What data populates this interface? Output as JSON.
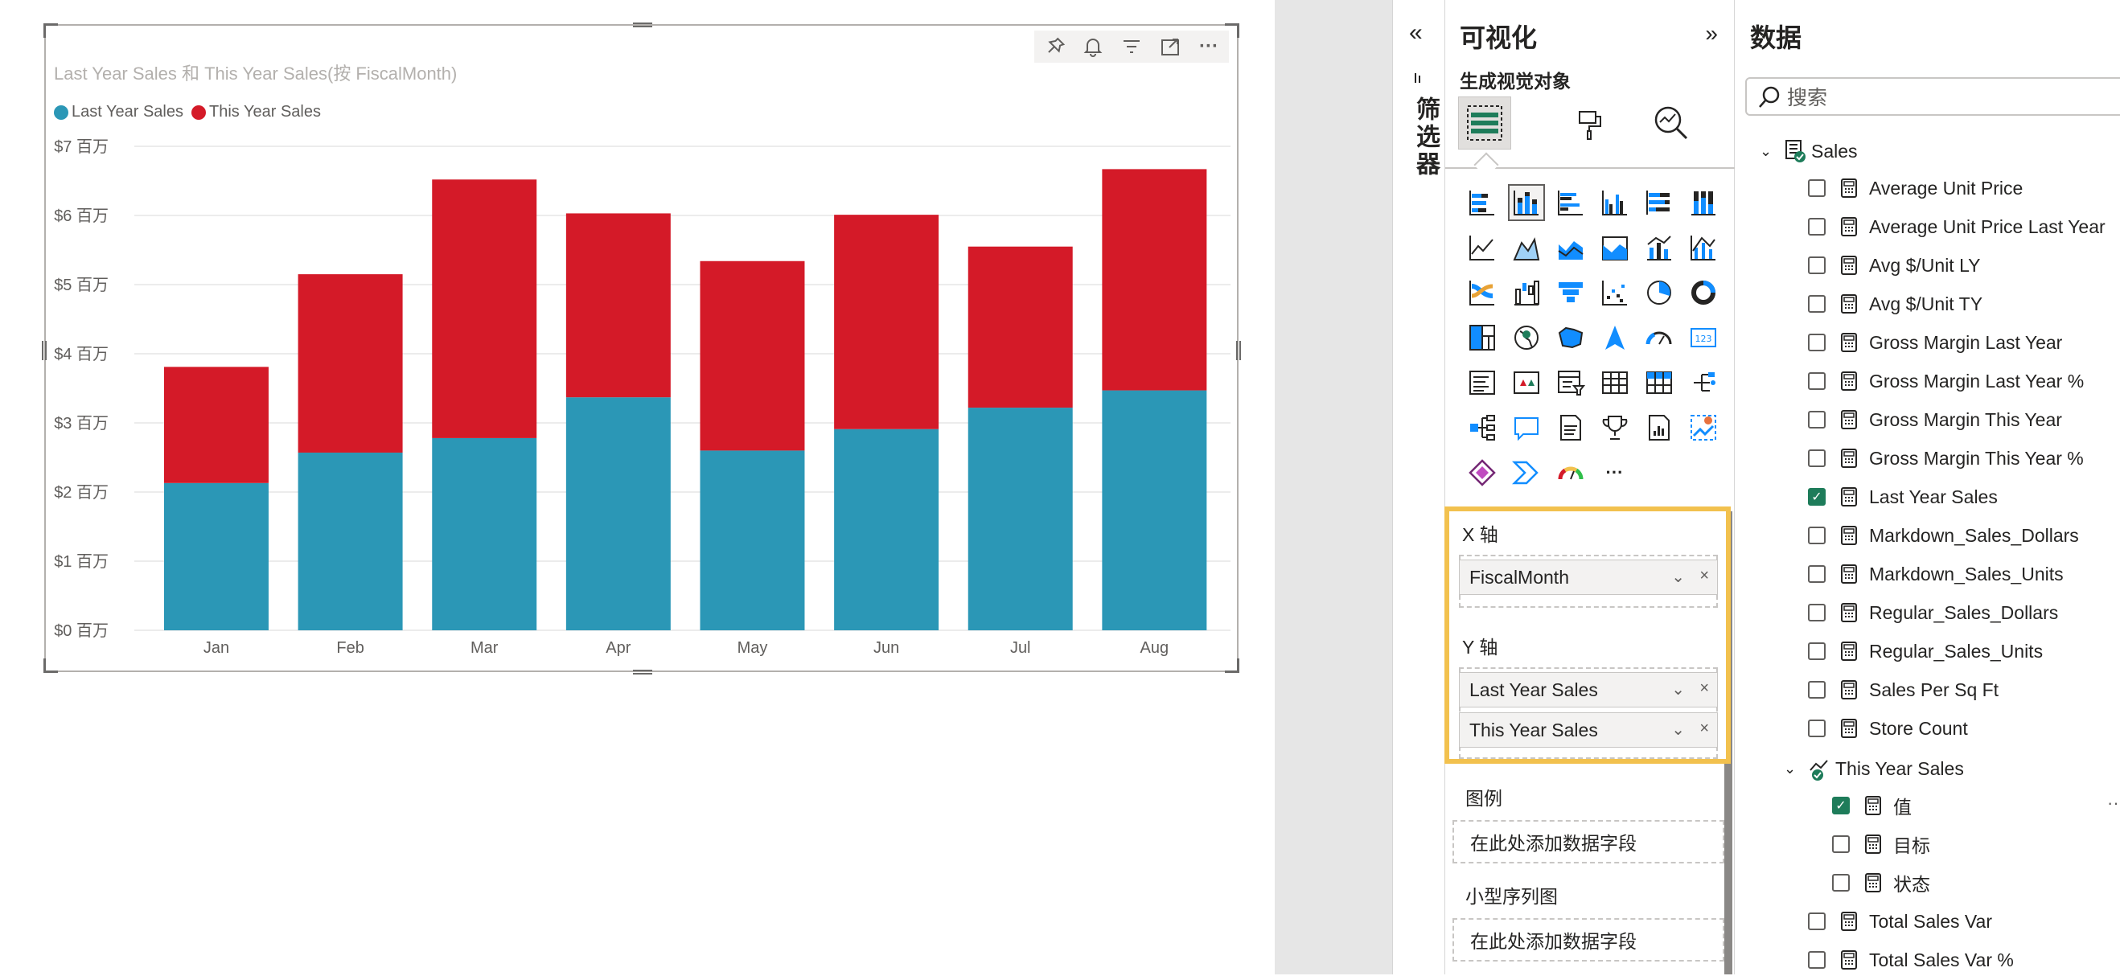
{
  "chart_data": {
    "type": "bar",
    "stacked": true,
    "title": "Last Year Sales 和 This Year Sales(按 FiscalMonth)",
    "categories": [
      "Jan",
      "Feb",
      "Mar",
      "Apr",
      "May",
      "Jun",
      "Jul",
      "Aug"
    ],
    "series": [
      {
        "name": "Last Year Sales",
        "color": "#2b97b6",
        "values": [
          2.13,
          2.57,
          2.78,
          3.37,
          2.6,
          2.91,
          3.22,
          3.47
        ]
      },
      {
        "name": "This Year Sales",
        "color": "#d41a28",
        "values": [
          1.68,
          2.58,
          3.74,
          2.66,
          2.74,
          3.1,
          2.33,
          3.2
        ]
      }
    ],
    "yticks": [
      "$0 百万",
      "$1 百万",
      "$2 百万",
      "$3 百万",
      "$4 百万",
      "$5 百万",
      "$6 百万",
      "$7 百万"
    ],
    "ylim": [
      0,
      7
    ],
    "grid": true,
    "legend_position": "top-left"
  },
  "visual_header": {
    "icons": [
      "pin-icon",
      "bell-icon",
      "filter-icon",
      "focus-mode-icon",
      "more-options-icon"
    ],
    "more": "···"
  },
  "filters": {
    "label": "筛选器",
    "collapse_icon": "«"
  },
  "visualizations": {
    "title": "可视化",
    "expand_icon": "»",
    "build_label": "生成视觉对象",
    "more": "···",
    "x_axis": {
      "label": "X 轴",
      "fields": [
        "FiscalMonth"
      ]
    },
    "y_axis": {
      "label": "Y 轴",
      "fields": [
        "Last Year Sales",
        "This Year Sales"
      ]
    },
    "legend": {
      "label": "图例",
      "placeholder": "在此处添加数据字段"
    },
    "small_multiples": {
      "label": "小型序列图",
      "placeholder": "在此处添加数据字段"
    },
    "pill_chevron": "⌄",
    "pill_remove": "×"
  },
  "data_pane": {
    "title": "数据",
    "search_placeholder": "搜索",
    "table": "Sales",
    "fields": [
      {
        "label": "Average Unit Price",
        "checked": false
      },
      {
        "label": "Average Unit Price Last Year",
        "checked": false
      },
      {
        "label": "Avg $/Unit LY",
        "checked": false
      },
      {
        "label": "Avg $/Unit TY",
        "checked": false
      },
      {
        "label": "Gross Margin Last Year",
        "checked": false
      },
      {
        "label": "Gross Margin Last Year %",
        "checked": false
      },
      {
        "label": "Gross Margin This Year",
        "checked": false
      },
      {
        "label": "Gross Margin This Year %",
        "checked": false
      },
      {
        "label": "Last Year Sales",
        "checked": true
      },
      {
        "label": "Markdown_Sales_Dollars",
        "checked": false
      },
      {
        "label": "Markdown_Sales_Units",
        "checked": false
      },
      {
        "label": "Regular_Sales_Dollars",
        "checked": false
      },
      {
        "label": "Regular_Sales_Units",
        "checked": false
      },
      {
        "label": "Sales Per Sq Ft",
        "checked": false
      },
      {
        "label": "Store Count",
        "checked": false
      }
    ],
    "kpi": {
      "label": "This Year Sales",
      "children": [
        {
          "label": "值",
          "checked": true
        },
        {
          "label": "目标",
          "checked": false
        },
        {
          "label": "状态",
          "checked": false
        }
      ]
    },
    "fields_after": [
      {
        "label": "Total Sales Var",
        "checked": false
      },
      {
        "label": "Total Sales Var %",
        "checked": false
      }
    ],
    "checkmark": "✓",
    "more": "···"
  }
}
